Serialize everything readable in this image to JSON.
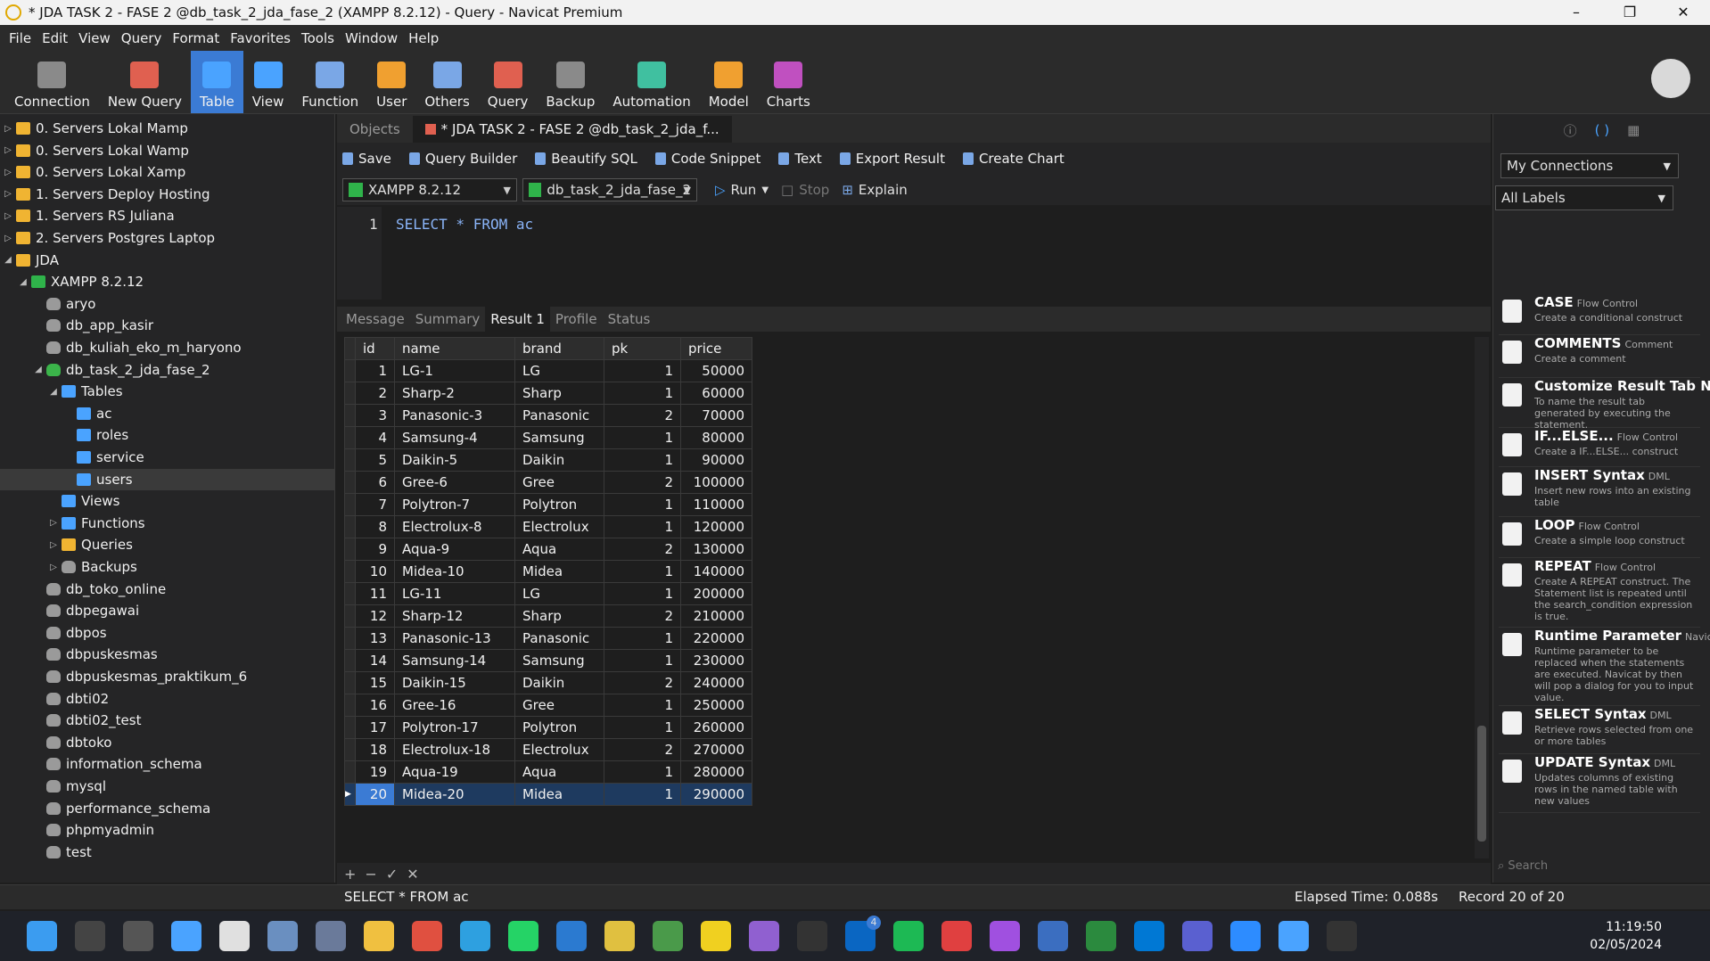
{
  "window": {
    "title": "* JDA TASK 2 - FASE 2 @db_task_2_jda_fase_2 (XAMPP 8.2.12) - Query - Navicat Premium",
    "minimize": "–",
    "maximize": "❐",
    "close": "✕"
  },
  "menu": [
    "File",
    "Edit",
    "View",
    "Query",
    "Format",
    "Favorites",
    "Tools",
    "Window",
    "Help"
  ],
  "toolbar": [
    {
      "label": "Connection",
      "color": "#8a8a8a"
    },
    {
      "label": "New Query",
      "color": "#e06050"
    },
    {
      "label": "Table",
      "color": "#4aa3ff",
      "active": true
    },
    {
      "label": "View",
      "color": "#4aa3ff"
    },
    {
      "label": "Function",
      "color": "#7aa7e6"
    },
    {
      "label": "User",
      "color": "#f0a030"
    },
    {
      "label": "Others",
      "color": "#7aa7e6"
    },
    {
      "label": "Query",
      "color": "#e06050"
    },
    {
      "label": "Backup",
      "color": "#8a8a8a"
    },
    {
      "label": "Automation",
      "color": "#40c0a0"
    },
    {
      "label": "Model",
      "color": "#f0a030"
    },
    {
      "label": "Charts",
      "color": "#c050c0"
    }
  ],
  "tree": [
    {
      "label": "0. Servers Lokal Mamp",
      "level": 0,
      "icon": "folder",
      "tw": "▷"
    },
    {
      "label": "0. Servers Lokal Wamp",
      "level": 0,
      "icon": "folder",
      "tw": "▷"
    },
    {
      "label": "0. Servers Lokal Xamp",
      "level": 0,
      "icon": "folder",
      "tw": "▷"
    },
    {
      "label": "1. Servers Deploy Hosting",
      "level": 0,
      "icon": "folder",
      "tw": "▷"
    },
    {
      "label": "1. Servers RS Juliana",
      "level": 0,
      "icon": "folder",
      "tw": "▷"
    },
    {
      "label": "2. Servers Postgres Laptop",
      "level": 0,
      "icon": "folder",
      "tw": "▷"
    },
    {
      "label": "JDA",
      "level": 0,
      "icon": "folder",
      "tw": "◢"
    },
    {
      "label": "XAMPP 8.2.12",
      "level": 1,
      "icon": "srv",
      "tw": "◢"
    },
    {
      "label": "aryo",
      "level": 2,
      "icon": "dbg",
      "tw": ""
    },
    {
      "label": "db_app_kasir",
      "level": 2,
      "icon": "dbg",
      "tw": ""
    },
    {
      "label": "db_kuliah_eko_m_haryono",
      "level": 2,
      "icon": "dbg",
      "tw": ""
    },
    {
      "label": "db_task_2_jda_fase_2",
      "level": 2,
      "icon": "dbgreen",
      "tw": "◢"
    },
    {
      "label": "Tables",
      "level": 3,
      "icon": "tbl",
      "tw": "◢"
    },
    {
      "label": "ac",
      "level": 4,
      "icon": "tbl",
      "tw": ""
    },
    {
      "label": "roles",
      "level": 4,
      "icon": "tbl",
      "tw": ""
    },
    {
      "label": "service",
      "level": 4,
      "icon": "tbl",
      "tw": ""
    },
    {
      "label": "users",
      "level": 4,
      "icon": "tbl",
      "tw": "",
      "selected": true
    },
    {
      "label": "Views",
      "level": 3,
      "icon": "tbl",
      "tw": ""
    },
    {
      "label": "Functions",
      "level": 3,
      "icon": "tbl",
      "tw": "▷"
    },
    {
      "label": "Queries",
      "level": 3,
      "icon": "folder",
      "tw": "▷"
    },
    {
      "label": "Backups",
      "level": 3,
      "icon": "dbg",
      "tw": "▷"
    },
    {
      "label": "db_toko_online",
      "level": 2,
      "icon": "dbg",
      "tw": ""
    },
    {
      "label": "dbpegawai",
      "level": 2,
      "icon": "dbg",
      "tw": ""
    },
    {
      "label": "dbpos",
      "level": 2,
      "icon": "dbg",
      "tw": ""
    },
    {
      "label": "dbpuskesmas",
      "level": 2,
      "icon": "dbg",
      "tw": ""
    },
    {
      "label": "dbpuskesmas_praktikum_6",
      "level": 2,
      "icon": "dbg",
      "tw": ""
    },
    {
      "label": "dbti02",
      "level": 2,
      "icon": "dbg",
      "tw": ""
    },
    {
      "label": "dbti02_test",
      "level": 2,
      "icon": "dbg",
      "tw": ""
    },
    {
      "label": "dbtoko",
      "level": 2,
      "icon": "dbg",
      "tw": ""
    },
    {
      "label": "information_schema",
      "level": 2,
      "icon": "dbg",
      "tw": ""
    },
    {
      "label": "mysql",
      "level": 2,
      "icon": "dbg",
      "tw": ""
    },
    {
      "label": "performance_schema",
      "level": 2,
      "icon": "dbg",
      "tw": ""
    },
    {
      "label": "phpmyadmin",
      "level": 2,
      "icon": "dbg",
      "tw": ""
    },
    {
      "label": "test",
      "level": 2,
      "icon": "dbg",
      "tw": ""
    }
  ],
  "tabs": {
    "objects": "Objects",
    "query": "* JDA TASK 2 - FASE 2 @db_task_2_jda_f..."
  },
  "querybar": [
    "Save",
    "Query Builder",
    "Beautify SQL",
    "Code Snippet",
    "Text",
    "Export Result",
    "Create Chart"
  ],
  "selects": {
    "connection": "XAMPP 8.2.12",
    "database": "db_task_2_jda_fase_2",
    "run": "Run",
    "stop": "Stop",
    "explain": "Explain"
  },
  "editor": {
    "line": "1",
    "code": "SELECT * FROM ac"
  },
  "result_tabs": [
    "Message",
    "Summary",
    "Result 1",
    "Profile",
    "Status"
  ],
  "grid": {
    "columns": [
      "id",
      "name",
      "brand",
      "pk",
      "price"
    ],
    "rows": [
      [
        "1",
        "LG-1",
        "LG",
        "1",
        "50000"
      ],
      [
        "2",
        "Sharp-2",
        "Sharp",
        "1",
        "60000"
      ],
      [
        "3",
        "Panasonic-3",
        "Panasonic",
        "2",
        "70000"
      ],
      [
        "4",
        "Samsung-4",
        "Samsung",
        "1",
        "80000"
      ],
      [
        "5",
        "Daikin-5",
        "Daikin",
        "1",
        "90000"
      ],
      [
        "6",
        "Gree-6",
        "Gree",
        "2",
        "100000"
      ],
      [
        "7",
        "Polytron-7",
        "Polytron",
        "1",
        "110000"
      ],
      [
        "8",
        "Electrolux-8",
        "Electrolux",
        "1",
        "120000"
      ],
      [
        "9",
        "Aqua-9",
        "Aqua",
        "2",
        "130000"
      ],
      [
        "10",
        "Midea-10",
        "Midea",
        "1",
        "140000"
      ],
      [
        "11",
        "LG-11",
        "LG",
        "1",
        "200000"
      ],
      [
        "12",
        "Sharp-12",
        "Sharp",
        "2",
        "210000"
      ],
      [
        "13",
        "Panasonic-13",
        "Panasonic",
        "1",
        "220000"
      ],
      [
        "14",
        "Samsung-14",
        "Samsung",
        "1",
        "230000"
      ],
      [
        "15",
        "Daikin-15",
        "Daikin",
        "2",
        "240000"
      ],
      [
        "16",
        "Gree-16",
        "Gree",
        "1",
        "250000"
      ],
      [
        "17",
        "Polytron-17",
        "Polytron",
        "1",
        "260000"
      ],
      [
        "18",
        "Electrolux-18",
        "Electrolux",
        "2",
        "270000"
      ],
      [
        "19",
        "Aqua-19",
        "Aqua",
        "1",
        "280000"
      ],
      [
        "20",
        "Midea-20",
        "Midea",
        "1",
        "290000"
      ]
    ]
  },
  "gridfoot": [
    "+",
    "−",
    "✓",
    "✕"
  ],
  "right": {
    "connections": "My Connections",
    "labels": "All Labels",
    "search": "Search",
    "snippets": [
      {
        "title": "CASE",
        "tag": "Flow Control",
        "desc": "Create a conditional construct"
      },
      {
        "title": "COMMENTS",
        "tag": "Comment",
        "desc": "Create a comment"
      },
      {
        "title": "Customize Result Tab Na",
        "tag": "",
        "desc": "To name the result tab generated by executing the statement."
      },
      {
        "title": "IF...ELSE...",
        "tag": "Flow Control",
        "desc": "Create a IF...ELSE... construct"
      },
      {
        "title": "INSERT Syntax",
        "tag": "DML",
        "desc": "Insert new rows into an existing table"
      },
      {
        "title": "LOOP",
        "tag": "Flow Control",
        "desc": "Create a simple loop construct"
      },
      {
        "title": "REPEAT",
        "tag": "Flow Control",
        "desc": "Create A REPEAT construct. The Statement list is repeated until the search_condition expression is true."
      },
      {
        "title": "Runtime Parameter",
        "tag": "Navic",
        "desc": "Runtime parameter to be replaced when the statements are executed. Navicat by then will pop a dialog for you to input value."
      },
      {
        "title": "SELECT Syntax",
        "tag": "DML",
        "desc": "Retrieve rows selected from one or more tables"
      },
      {
        "title": "UPDATE Syntax",
        "tag": "DML",
        "desc": "Updates columns of existing rows in the named table with new values"
      }
    ]
  },
  "status": {
    "sql": "SELECT * FROM ac",
    "elapsed": "Elapsed Time: 0.088s",
    "record": "Record 20 of 20"
  },
  "taskbar": {
    "time": "11:19:50",
    "date": "02/05/2024",
    "badge": "4"
  }
}
